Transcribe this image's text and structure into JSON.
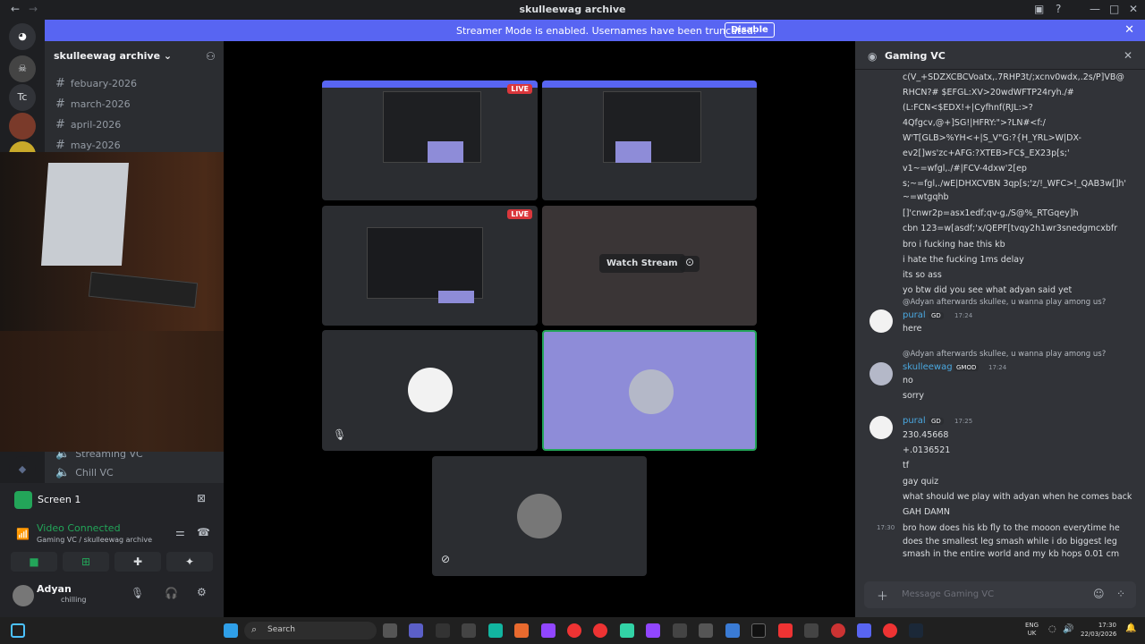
{
  "window": {
    "title": "skulleewag archive"
  },
  "banner": {
    "message": "Streamer Mode is enabled. Usernames have been truncated.",
    "button": "Disable"
  },
  "servers": {
    "tc_label": "Tc"
  },
  "sidebar": {
    "guild_name": "skulleewag archive",
    "channels": [
      "febuary-2026",
      "march-2026",
      "april-2026",
      "may-2026"
    ],
    "voice_channels": [
      "Streaming VC",
      "Chill VC"
    ]
  },
  "screen_panel": {
    "label": "Screen 1"
  },
  "connection": {
    "status": "Video Connected",
    "location": "Gaming VC / skulleewag archive"
  },
  "user": {
    "name": "Adyan",
    "status": "chilling"
  },
  "stage": {
    "watch_label": "Watch Stream",
    "live_label": "LIVE"
  },
  "chat": {
    "channel": "Gaming VC",
    "placeholder": "Message Gaming VC",
    "early_lines": [
      "c(V_+SDZXCBCVoatx,.7RHP3t/;xcnv0wdx,.2s/P]VB@",
      "RHCN?# $EFGL:XV>20wdWFTP24ryh./#",
      "(L:FCN<$EDX!+|Cyfhnf(RJL:>?",
      "4Qfgcv,@+]SG!|HFRY:\">?LN#<f:/",
      "W'T[GLB>%YH<+|S_V\"G:?{H_YRL>W|DX-",
      "ev2[]ws'zc+AFG:?XTEB>FC$_EX23p[s;'",
      "v1~=wfgl,./#|FCV-4dxw'2[ep",
      "s;~=fgl,./wE|DHXCVBN 3qp[s;'z/!_WFC>!_QAB3w[]h'",
      "~=wtgqhb",
      "[]'cnwr2p=asx1edf;qv-g,/S@%_RTGqey]h",
      "cbn 123=w[asdf;'x/QEPF[tvqy2h1wr3snedgmcxbfr",
      "bro i fucking hae this kb",
      "i hate the fucking 1ms delay",
      "its so ass",
      "yo btw did you see what adyan said yet"
    ],
    "messages": [
      {
        "reply_to": "@Adyan",
        "reply_text": "afterwards skullee, u wanna play among us?",
        "author": "pural",
        "badge": "GD",
        "time": "17:24",
        "lines": [
          "here"
        ]
      },
      {
        "reply_to": "@Adyan",
        "reply_text": "afterwards skullee, u wanna play among us?",
        "author": "skulleewag",
        "badge": "GMOD",
        "time": "17:24",
        "lines": [
          "no",
          "sorry"
        ]
      },
      {
        "author": "pural",
        "badge": "GD",
        "time": "17:25",
        "lines": [
          "230.45668",
          "+.0136521",
          "tf",
          "gay quiz",
          "what should we play with adyan when he comes back",
          "GAH DAMN"
        ]
      }
    ],
    "last_message": {
      "time": "17:30",
      "text": "bro how does his kb fly to the mooon everytime he does the smallest leg smash while i do biggest leg smash in the entire world and my kb hops 0.01 cm"
    }
  },
  "taskbar": {
    "search": "Search",
    "lang": "ENG",
    "region": "UK",
    "time": "17:30",
    "date": "22/03/2026"
  },
  "colors": {
    "accent": "#5865f2",
    "connected": "#23a559",
    "live": "#da373c",
    "highlight_tile": "#8e8cd8"
  }
}
